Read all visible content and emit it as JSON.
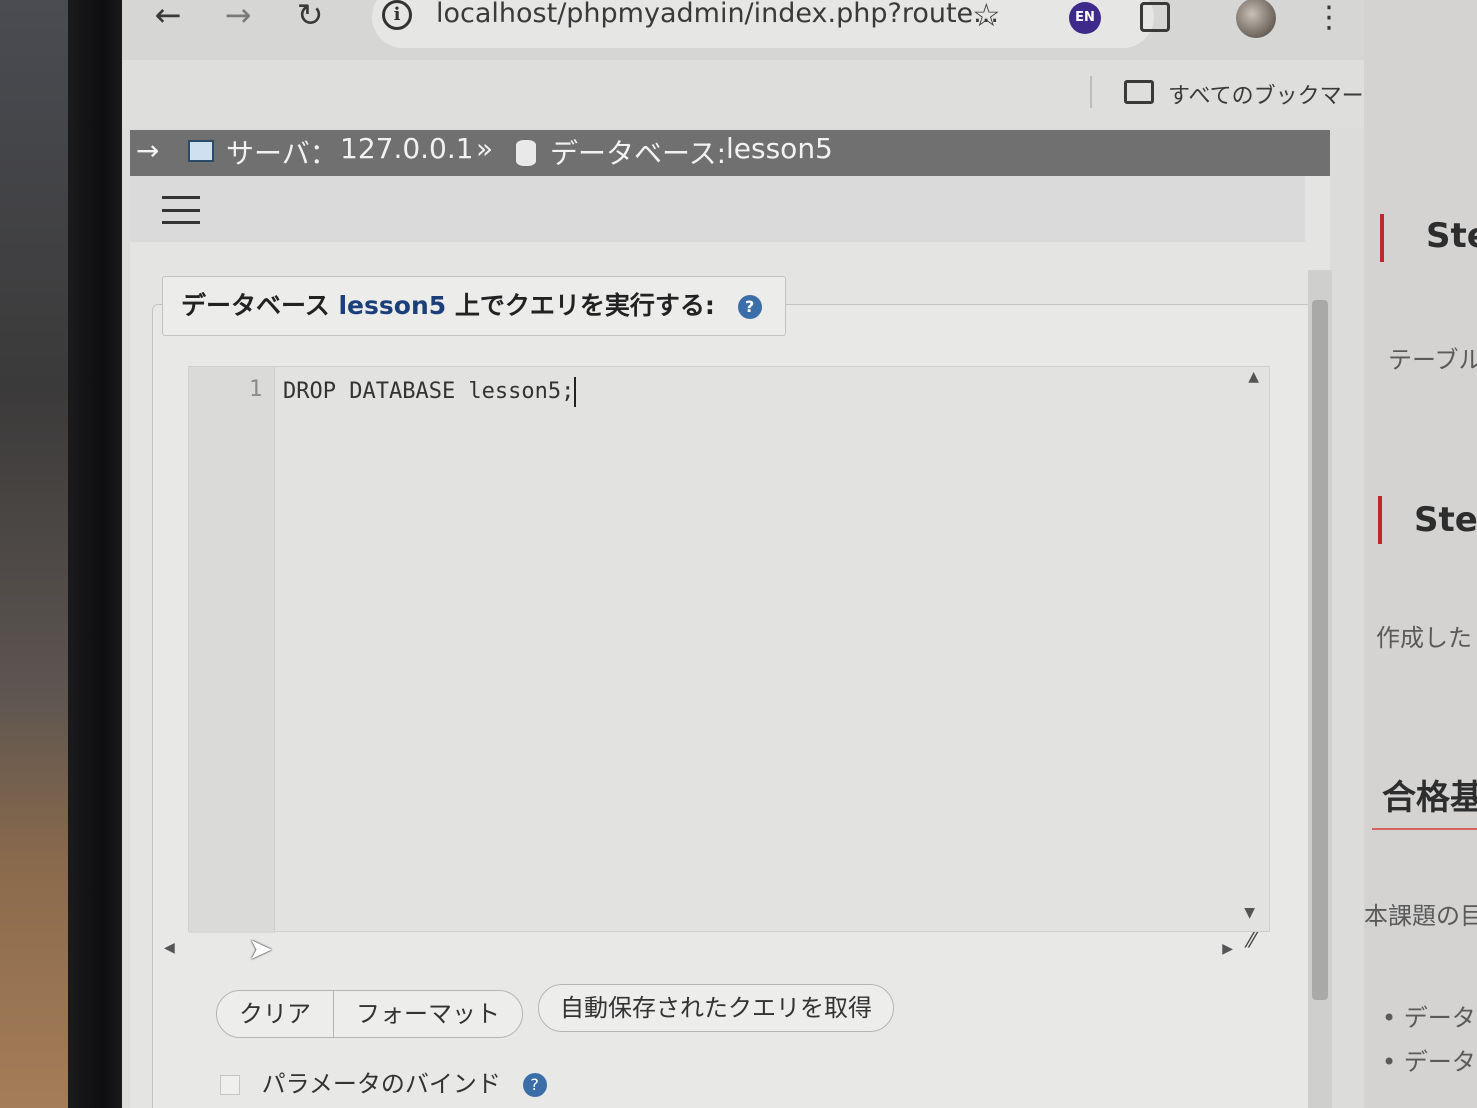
{
  "browser": {
    "url": "localhost/phpmyadmin/index.php?route...",
    "extension_badge": "EN",
    "bookmarks_label": "すべてのブックマーク"
  },
  "breadcrumb": {
    "server_label": "サーバ：",
    "server_value": "127.0.0.1",
    "separator": "»",
    "database_label": "データベース:",
    "database_value": "lesson5"
  },
  "query_panel": {
    "legend_prefix": "データベース",
    "legend_db": "lesson5",
    "legend_suffix": "上でクエリを実行する:",
    "line_number": "1",
    "sql": "DROP DATABASE lesson5;"
  },
  "buttons": {
    "clear": "クリア",
    "format": "フォーマット",
    "autosave": "自動保存されたクエリを取得"
  },
  "bind_params_label": "パラメータのバインド",
  "right_window": {
    "heading_1": "Ste",
    "text_1": "テーブル",
    "heading_2": "Ste",
    "text_2": "作成した",
    "heading_3": "合格基",
    "text_3": "本課題の目",
    "bullet_1": "• データ",
    "bullet_2": "• データ"
  },
  "colors": {
    "breadcrumb_bg": "#707070",
    "accent_red": "#c0282a",
    "db_name_blue": "#1a3f7a"
  }
}
